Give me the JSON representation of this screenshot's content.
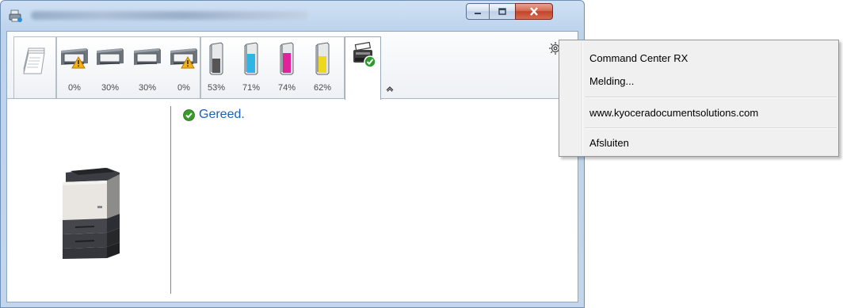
{
  "window": {
    "title_obscured": true,
    "caption_buttons": [
      "minimize",
      "maximize",
      "close"
    ]
  },
  "toolbar": {
    "trays": [
      {
        "percent": "0%",
        "warning": true
      },
      {
        "percent": "30%",
        "warning": false
      },
      {
        "percent": "30%",
        "warning": false
      },
      {
        "percent": "0%",
        "warning": true
      }
    ],
    "toners": [
      {
        "color_name": "black",
        "color": "#555555",
        "percent": "53%",
        "level": 0.53
      },
      {
        "color_name": "cyan",
        "color": "#2fb4e6",
        "percent": "71%",
        "level": 0.71
      },
      {
        "color_name": "magenta",
        "color": "#e0239b",
        "percent": "74%",
        "level": 0.74
      },
      {
        "color_name": "yellow",
        "color": "#ecd81e",
        "percent": "62%",
        "level": 0.62
      }
    ]
  },
  "status": {
    "text": "Gereed.",
    "icon": "check-circle-icon",
    "color": "#1d5fb5"
  },
  "menu": {
    "items": [
      {
        "label": "Command Center RX"
      },
      {
        "label": "Melding..."
      },
      {
        "label": "www.kyoceradocumentsolutions.com"
      },
      {
        "label": "Afsluiten"
      }
    ]
  }
}
